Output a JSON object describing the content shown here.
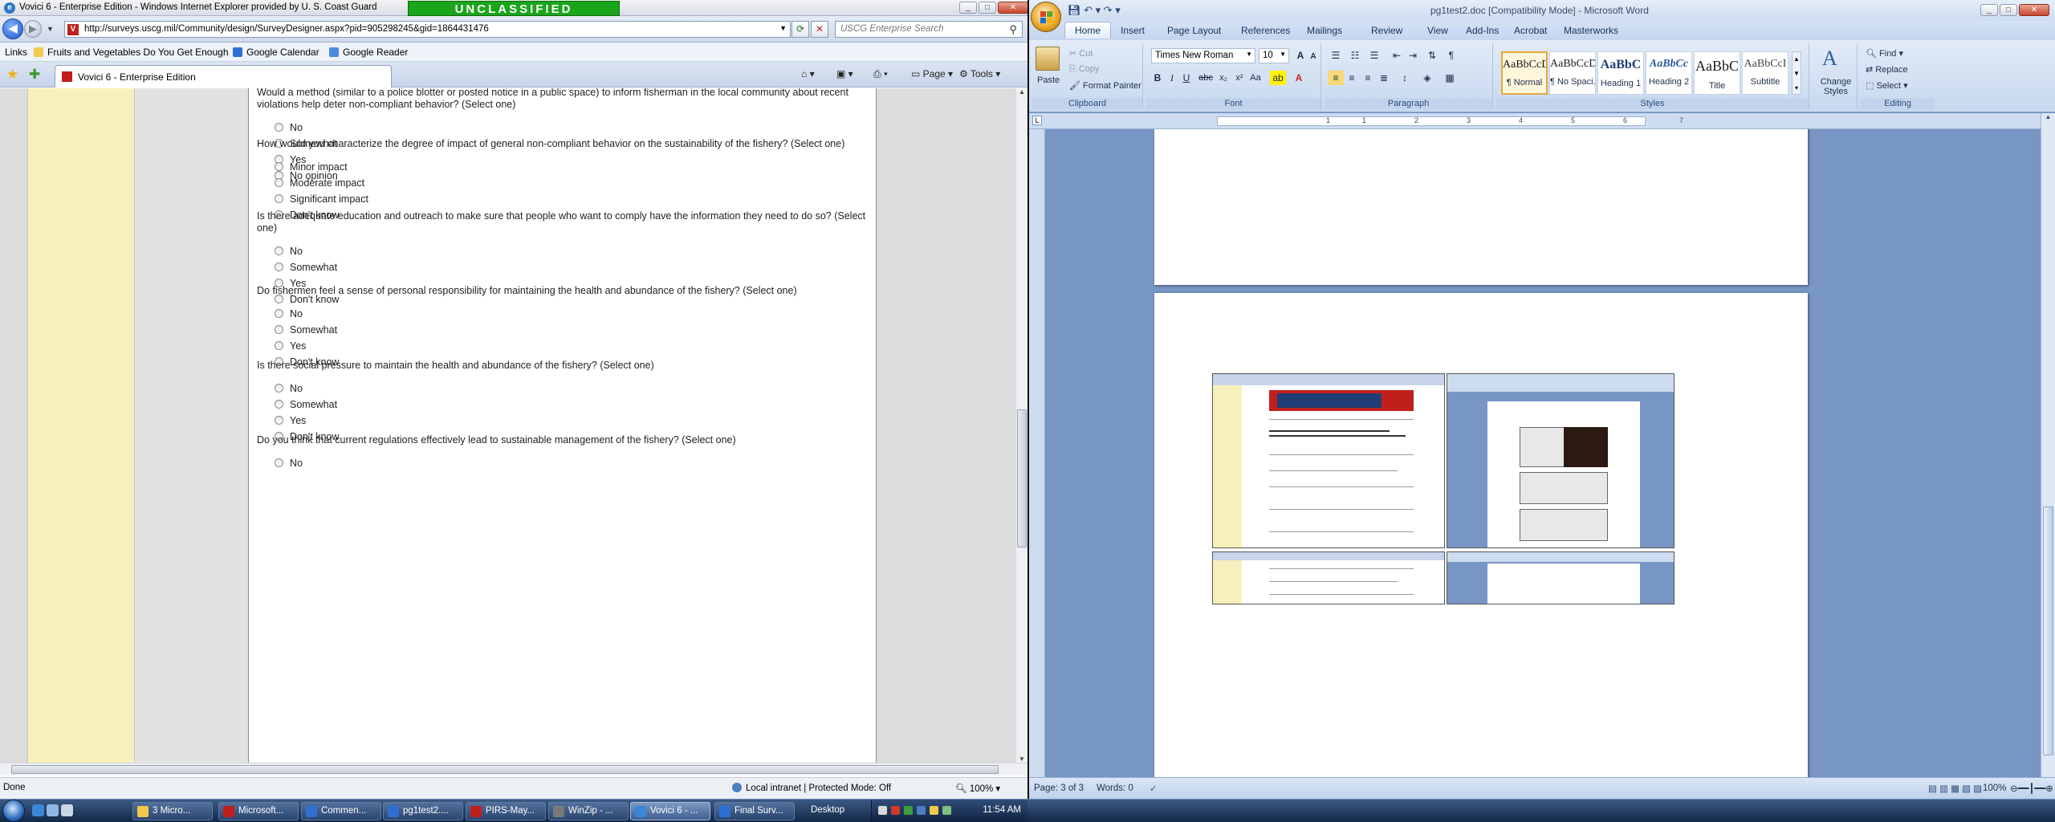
{
  "ie": {
    "title": "Vovici 6 - Enterprise Edition - Windows Internet Explorer provided by U. S. Coast Guard",
    "classification": "UNCLASSIFIED",
    "url": "http://surveys.uscg.mil/Community/design/SurveyDesigner.aspx?pid=905298245&gid=1864431476",
    "search_placeholder": "USCG Enterprise Search",
    "links_label": "Links",
    "links": [
      "Fruits and Vegetables Do You Get Enough",
      "Google Calendar",
      "Google Reader"
    ],
    "tab_title": "Vovici 6 - Enterprise Edition",
    "cmd_page": "Page",
    "cmd_tools": "Tools",
    "status_done": "Done",
    "status_zone": "Local intranet | Protected Mode: Off",
    "zoom": "100%"
  },
  "survey": {
    "questions": [
      {
        "text": "Would a method (similar to a police blotter or posted notice in a public space) to inform fisherman in the local community about recent violations help deter non-compliant behavior? (Select one)",
        "options": [
          "No",
          "Somewhat",
          "Yes",
          "No opinion"
        ]
      },
      {
        "text": "How would you characterize the degree of impact of general non-compliant behavior on the sustainability of the fishery? (Select one)",
        "options": [
          "Minor impact",
          "Moderate impact",
          "Significant impact",
          "Don't know"
        ]
      },
      {
        "text": "Is there adequate education and outreach to make sure that people who want to comply have the information they need to do so? (Select one)",
        "options": [
          "No",
          "Somewhat",
          "Yes",
          "Don't know"
        ]
      },
      {
        "text": "Do fishermen feel a sense of personal responsibility for maintaining the health and abundance of the fishery? (Select one)",
        "options": [
          "No",
          "Somewhat",
          "Yes",
          "Don't know"
        ]
      },
      {
        "text": "Is there social pressure to maintain the health and abundance of the fishery? (Select one)",
        "options": [
          "No",
          "Somewhat",
          "Yes",
          "Don't know"
        ]
      },
      {
        "text": "Do you think that current regulations effectively lead to sustainable management of the fishery? (Select one)",
        "options": [
          "No"
        ]
      }
    ]
  },
  "word": {
    "title": "pg1test2.doc [Compatibility Mode] - Microsoft Word",
    "tabs": [
      "Home",
      "Insert",
      "Page Layout",
      "References",
      "Mailings",
      "Review",
      "View",
      "Add-Ins",
      "Acrobat",
      "Masterworks"
    ],
    "clipboard": {
      "paste": "Paste",
      "cut": "Cut",
      "copy": "Copy",
      "format_painter": "Format Painter",
      "label": "Clipboard"
    },
    "font": {
      "name": "Times New Roman",
      "size": "10",
      "label": "Font"
    },
    "paragraph_label": "Paragraph",
    "styles": [
      {
        "sample": "AaBbCcDc",
        "name": "¶ Normal"
      },
      {
        "sample": "AaBbCcDc",
        "name": "¶ No Spaci..."
      },
      {
        "sample": "AaBbC",
        "name": "Heading 1"
      },
      {
        "sample": "AaBbCc",
        "name": "Heading 2"
      },
      {
        "sample": "AaBbC",
        "name": "Title"
      },
      {
        "sample": "AaBbCcI",
        "name": "Subtitle"
      }
    ],
    "styles_label": "Styles",
    "change_styles": "Change Styles",
    "editing": {
      "find": "Find",
      "replace": "Replace",
      "select": "Select",
      "label": "Editing"
    },
    "ruler_numbers": [
      "1",
      "1",
      "2",
      "3",
      "4",
      "5",
      "6",
      "7"
    ],
    "status_page": "Page: 3 of 3",
    "status_words": "Words: 0",
    "zoom": "100%"
  },
  "taskbar": {
    "buttons": [
      "3 Micro...",
      "Microsoft...",
      "Commen...",
      "pg1test2....",
      "PIRS-May...",
      "WinZip - ...",
      "Vovici 6 - ...",
      "Final Surv..."
    ],
    "desktop": "Desktop",
    "clock": "11:54 AM"
  }
}
